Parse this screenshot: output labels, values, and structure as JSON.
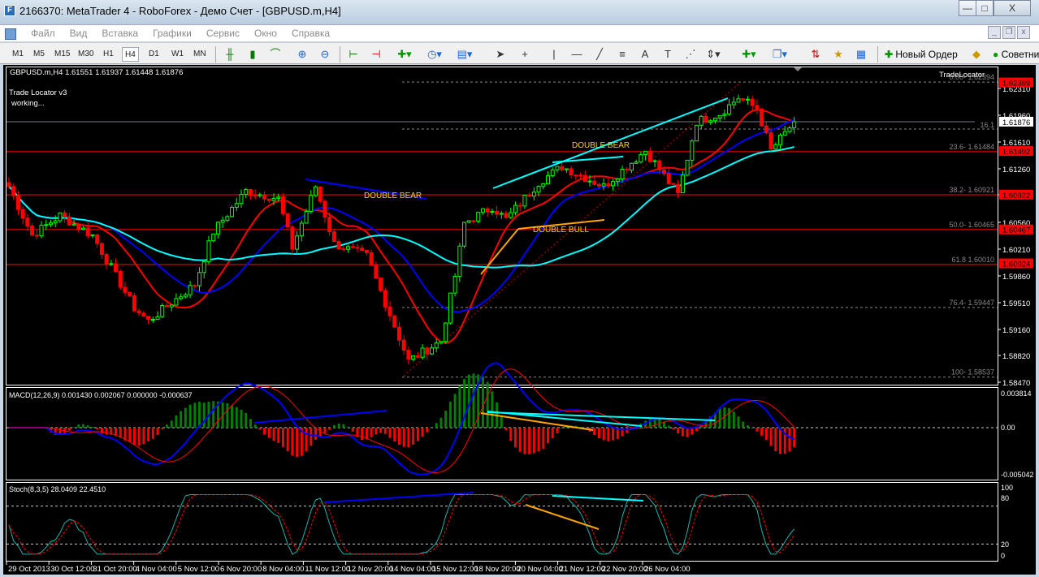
{
  "window": {
    "title": "2166370: MetaTrader 4 - RoboForex - Демо Счет - [GBPUSD.m,H4]",
    "min": "—",
    "max": "□",
    "close": "X"
  },
  "menu": [
    "Файл",
    "Вид",
    "Вставка",
    "Графики",
    "Сервис",
    "Окно",
    "Справка"
  ],
  "timeframes": [
    "M1",
    "M5",
    "M15",
    "M30",
    "H1",
    "H4",
    "D1",
    "W1",
    "MN"
  ],
  "active_timeframe": "H4",
  "toolbar": {
    "new_order": "Новый Ордер",
    "advisors": "Советники"
  },
  "chart": {
    "header": "GBPUSD.m,H4  1.61551 1.61937 1.61448 1.61876",
    "indicator_name": "Trade Locator v3",
    "indicator_status": "working...",
    "tradelocator_label": "TradeLocator",
    "price_ticks": [
      "1.62310",
      "1.61960",
      "1.61610",
      "1.61260",
      "1.60920",
      "1.60560",
      "1.60210",
      "1.59860",
      "1.59510",
      "1.59160",
      "1.58820",
      "1.58470"
    ],
    "price_labels": [
      {
        "text": "1.62389",
        "color": "#ff0000",
        "price": 1.62389
      },
      {
        "text": "1.61876",
        "color": "#ffffff",
        "price": 1.61876
      },
      {
        "text": "1.61492",
        "color": "#ff0000",
        "price": 1.61492
      },
      {
        "text": "1.60922",
        "color": "#ff0000",
        "price": 1.60922
      },
      {
        "text": "1.60467",
        "color": "#ff0000",
        "price": 1.60467
      },
      {
        "text": "1.60024",
        "color": "#ff0000",
        "price": 1.60024
      }
    ],
    "fib_levels": [
      {
        "label": "0.00- 1.62394",
        "price": 1.62394
      },
      {
        "label": "23.6- 1.61484",
        "price": 1.61484
      },
      {
        "label": "38.2- 1.60921",
        "price": 1.60921
      },
      {
        "label": "50.0- 1.60465",
        "price": 1.60465
      },
      {
        "label": "61.8 1.60010",
        "price": 1.6001
      },
      {
        "label": "76.4- 1.59447",
        "price": 1.59447
      },
      {
        "label": "100- 1.58537",
        "price": 1.58537
      }
    ],
    "level_16": "16.1",
    "patterns": [
      {
        "text": "DOUBLE  BEAR",
        "color": "#ffd700"
      },
      {
        "text": "DOUBLE  BEAR",
        "color": "#ffd700"
      },
      {
        "text": "DOUBLE  BULL",
        "color": "#ffd700"
      }
    ],
    "price_path": [
      [
        0,
        1.6103
      ],
      [
        5,
        1.6039
      ],
      [
        11,
        1.6065
      ],
      [
        18,
        1.6039
      ],
      [
        27,
        1.5944
      ],
      [
        30,
        1.5927
      ],
      [
        40,
        1.5975
      ],
      [
        44,
        1.6044
      ],
      [
        51,
        1.6097
      ],
      [
        58,
        1.6087
      ],
      [
        61,
        1.6023
      ],
      [
        66,
        1.6103
      ],
      [
        70,
        1.6028
      ],
      [
        77,
        1.6012
      ],
      [
        86,
        1.5875
      ],
      [
        93,
        1.5901
      ],
      [
        96,
        1.5986
      ],
      [
        98,
        1.6055
      ],
      [
        104,
        1.6076
      ],
      [
        107,
        1.606
      ],
      [
        114,
        1.6108
      ],
      [
        119,
        1.6129
      ],
      [
        128,
        1.6103
      ],
      [
        137,
        1.615
      ],
      [
        144,
        1.6092
      ],
      [
        148,
        1.6188
      ],
      [
        153,
        1.6198
      ],
      [
        157,
        1.6219
      ],
      [
        161,
        1.6205
      ],
      [
        164,
        1.615
      ],
      [
        169,
        1.61876
      ]
    ],
    "macd": {
      "label": "MACD(12,26,9) 0.001430 0.002067 0.000000 -0.000637",
      "top": "0.003814",
      "zero": "0.00",
      "bottom": "-0.005042"
    },
    "stoch": {
      "label": "Stoch(8,3,5) 28.0409 22.4510",
      "ticks": [
        "100",
        "80",
        "20",
        "0"
      ]
    },
    "time_labels": [
      "29 Oct 2013",
      "30 Oct 12:00",
      "31 Oct 20:00",
      "4 Nov 04:00",
      "5 Nov 12:00",
      "6 Nov 20:00",
      "8 Nov 04:00",
      "11 Nov 12:00",
      "12 Nov 20:00",
      "14 Nov 04:00",
      "15 Nov 12:00",
      "18 Nov 20:00",
      "20 Nov 04:00",
      "21 Nov 12:00",
      "22 Nov 20:00",
      "26 Nov 04:00"
    ]
  },
  "colors": {
    "bull": "#00ff00",
    "bear": "#ff0000",
    "ma_fast": "#ff0000",
    "ma_mid": "#0000ff",
    "ma_slow": "#00ffff"
  }
}
